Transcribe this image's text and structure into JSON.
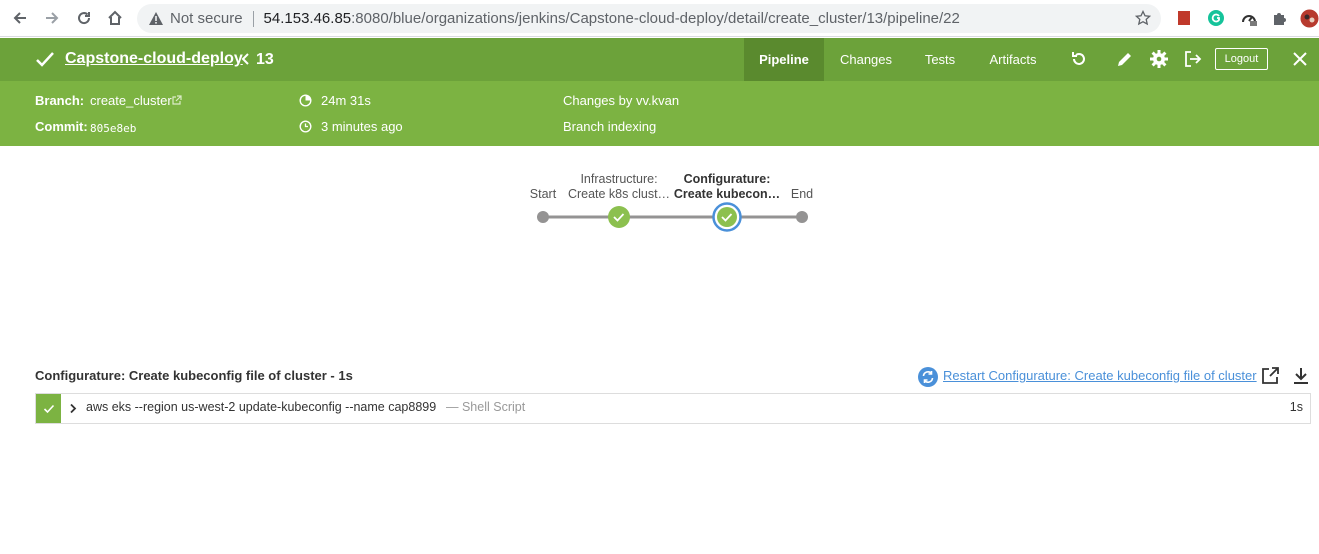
{
  "browser": {
    "security_label": "Not secure",
    "url_host": "54.153.46.85",
    "url_rest": ":8080/blue/organizations/jenkins/Capstone-cloud-deploy/detail/create_cluster/13/pipeline/22"
  },
  "header": {
    "project_name": "Capstone-cloud-deploy",
    "run_number": "13",
    "tabs": [
      {
        "label": "Pipeline",
        "active": true
      },
      {
        "label": "Changes"
      },
      {
        "label": "Tests"
      },
      {
        "label": "Artifacts"
      }
    ],
    "logout_label": "Logout"
  },
  "meta": {
    "branch_label": "Branch:",
    "branch_value": "create_cluster",
    "commit_label": "Commit:",
    "commit_value": "805e8eb",
    "duration": "24m 31s",
    "time_ago": "3 minutes ago",
    "changes": "Changes by vv.kvan",
    "trigger": "Branch indexing"
  },
  "pipeline": {
    "stages": [
      {
        "line1": "",
        "line2": "Start",
        "status": "none"
      },
      {
        "line1": "Infrastructure:",
        "line2": "Create k8s clust…",
        "status": "success"
      },
      {
        "line1": "Configurature:",
        "line2": "Create kubecon…",
        "status": "success",
        "selected": true
      },
      {
        "line1": "",
        "line2": "End",
        "status": "none"
      }
    ]
  },
  "step_panel": {
    "title": "Configurature: Create kubeconfig file of cluster - 1s",
    "restart_label": "Restart Configurature: Create kubeconfig file of cluster",
    "steps": [
      {
        "command": "aws eks --region us-west-2 update-kubeconfig --name cap8899",
        "type": "— Shell Script",
        "duration": "1s",
        "status": "success"
      }
    ]
  },
  "colors": {
    "header_dark": "#6ca23a",
    "header_light": "#7cb342",
    "success": "#8cc04f",
    "selected_ring": "#4a90d9",
    "link": "#4a90d9"
  }
}
